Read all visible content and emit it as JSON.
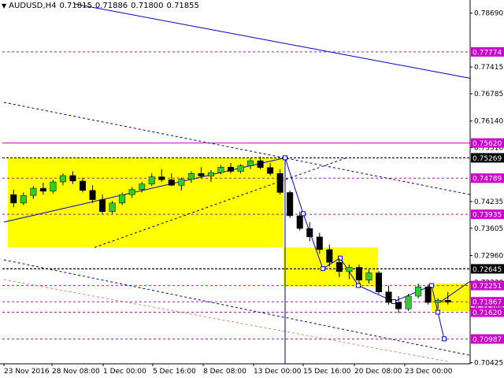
{
  "header": {
    "symbol_timeframe": "AUDUSD,H4",
    "open": "0.71815",
    "high": "0.71886",
    "low": "0.71800",
    "close": "0.71855"
  },
  "colors": {
    "background": "#ffffff",
    "zone": "#ffff00",
    "bull_candle": "#2ecc2e",
    "bear_candle": "#000000",
    "trend_line": "#0000cc",
    "level_line": "#cc00cc",
    "support_line": "#d4896b",
    "marker_label": "#cc00cc"
  },
  "chart_data": {
    "type": "candlestick",
    "title": "AUDUSD,H4",
    "ylim": [
      0.704,
      0.79
    ],
    "x_ticks": [
      "23 Nov 2016",
      "28 Nov 08:00",
      "1 Dec 00:00",
      "5 Dec 16:00",
      "8 Dec 08:00",
      "13 Dec 00:00",
      "15 Dec 16:00",
      "20 Dec 08:00",
      "23 Dec 00:00"
    ],
    "y_ticks": [
      "0.78690",
      "0.77415",
      "0.76785",
      "0.76140",
      "0.75510",
      "0.74235",
      "0.73605",
      "0.72960",
      "0.72330",
      "0.71700",
      "0.70425"
    ],
    "level_labels": [
      {
        "text": "0.77774",
        "value": 0.77774,
        "style": "magenta"
      },
      {
        "text": "0.75620",
        "value": 0.7562,
        "style": "magenta-solid"
      },
      {
        "text": "0.75269",
        "value": 0.75269,
        "style": "black"
      },
      {
        "text": "0.74789",
        "value": 0.74789,
        "style": "magenta"
      },
      {
        "text": "0.73935",
        "value": 0.73935,
        "style": "magenta"
      },
      {
        "text": "0.72645",
        "value": 0.72645,
        "style": "black"
      },
      {
        "text": "0.72251",
        "value": 0.72251,
        "style": "magenta"
      },
      {
        "text": "0.71867",
        "value": 0.71867,
        "style": "magenta"
      },
      {
        "text": "0.71620",
        "value": 0.7162,
        "style": "magenta"
      },
      {
        "text": "0.70987",
        "value": 0.70987,
        "style": "magenta"
      }
    ],
    "candles": [
      [
        0.744,
        0.7452,
        0.741,
        0.742
      ],
      [
        0.742,
        0.7445,
        0.7415,
        0.7438
      ],
      [
        0.7438,
        0.746,
        0.743,
        0.7455
      ],
      [
        0.7455,
        0.7468,
        0.744,
        0.7448
      ],
      [
        0.7448,
        0.7475,
        0.7442,
        0.747
      ],
      [
        0.747,
        0.749,
        0.7462,
        0.7485
      ],
      [
        0.7485,
        0.7495,
        0.7465,
        0.7472
      ],
      [
        0.7472,
        0.748,
        0.7445,
        0.745
      ],
      [
        0.745,
        0.7462,
        0.742,
        0.7428
      ],
      [
        0.7428,
        0.744,
        0.7395,
        0.74
      ],
      [
        0.74,
        0.7425,
        0.7395,
        0.742
      ],
      [
        0.742,
        0.7445,
        0.7415,
        0.744
      ],
      [
        0.744,
        0.7458,
        0.7432,
        0.7452
      ],
      [
        0.7452,
        0.747,
        0.7445,
        0.7465
      ],
      [
        0.7465,
        0.749,
        0.746,
        0.7482
      ],
      [
        0.7482,
        0.75,
        0.747,
        0.7475
      ],
      [
        0.7475,
        0.749,
        0.746,
        0.7462
      ],
      [
        0.7462,
        0.748,
        0.745,
        0.7476
      ],
      [
        0.7476,
        0.7495,
        0.7468,
        0.749
      ],
      [
        0.749,
        0.7505,
        0.7478,
        0.7484
      ],
      [
        0.7484,
        0.7498,
        0.747,
        0.7492
      ],
      [
        0.7492,
        0.751,
        0.7488,
        0.7505
      ],
      [
        0.7505,
        0.7515,
        0.749,
        0.7495
      ],
      [
        0.7495,
        0.7512,
        0.749,
        0.7508
      ],
      [
        0.7508,
        0.7525,
        0.75,
        0.752
      ],
      [
        0.752,
        0.753,
        0.75,
        0.7504
      ],
      [
        0.7504,
        0.7515,
        0.7485,
        0.749
      ],
      [
        0.749,
        0.75,
        0.744,
        0.7445
      ],
      [
        0.7445,
        0.745,
        0.7385,
        0.739
      ],
      [
        0.739,
        0.74,
        0.7355,
        0.736
      ],
      [
        0.736,
        0.7375,
        0.733,
        0.734
      ],
      [
        0.734,
        0.735,
        0.73,
        0.731
      ],
      [
        0.731,
        0.7322,
        0.727,
        0.728
      ],
      [
        0.728,
        0.729,
        0.7245,
        0.7258
      ],
      [
        0.7258,
        0.7275,
        0.724,
        0.7268
      ],
      [
        0.7268,
        0.7275,
        0.723,
        0.7238
      ],
      [
        0.7238,
        0.7262,
        0.723,
        0.7255
      ],
      [
        0.7255,
        0.726,
        0.7205,
        0.721
      ],
      [
        0.721,
        0.7225,
        0.718,
        0.7185
      ],
      [
        0.7185,
        0.72,
        0.716,
        0.717
      ],
      [
        0.717,
        0.7205,
        0.7165,
        0.72
      ],
      [
        0.72,
        0.723,
        0.7195,
        0.7222
      ],
      [
        0.7222,
        0.7228,
        0.718,
        0.7185
      ],
      [
        0.7185,
        0.7195,
        0.717,
        0.719
      ],
      [
        0.719,
        0.721,
        0.718,
        0.7186
      ]
    ]
  }
}
